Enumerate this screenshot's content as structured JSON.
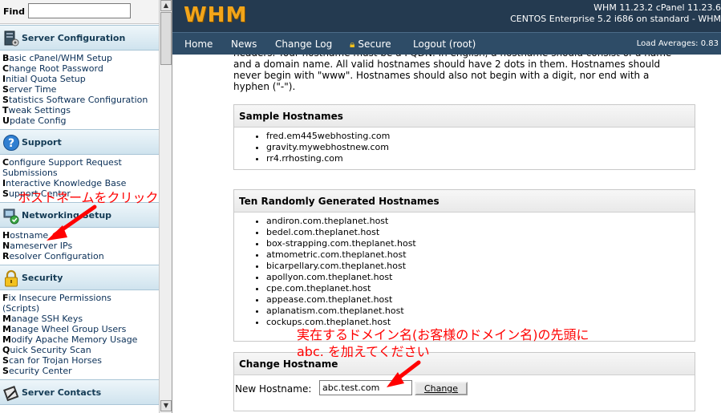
{
  "sidebar": {
    "find_label": "Find",
    "find_value": "",
    "sections": [
      {
        "title": "Server Configuration",
        "icon": "server-icon",
        "links": [
          {
            "first": "B",
            "rest": "asic cPanel/WHM Setup"
          },
          {
            "first": "C",
            "rest": "hange Root Password"
          },
          {
            "first": "I",
            "rest": "nitial Quota Setup"
          },
          {
            "first": "S",
            "rest": "erver Time"
          },
          {
            "first": "S",
            "rest": "tatistics Software Configuration"
          },
          {
            "first": "T",
            "rest": "weak Settings"
          },
          {
            "first": "U",
            "rest": "pdate Config"
          }
        ]
      },
      {
        "title": "Support",
        "icon": "help-icon",
        "links": [
          {
            "first": "C",
            "rest": "onfigure Support Request"
          },
          {
            "first": "",
            "rest": "Submissions"
          },
          {
            "first": "I",
            "rest": "nteractive Knowledge Base"
          },
          {
            "first": "S",
            "rest": "upport Center"
          }
        ]
      },
      {
        "title": "Networking Setup",
        "icon": "network-icon",
        "links": [
          {
            "first": "H",
            "rest": "ostname"
          },
          {
            "first": "N",
            "rest": "ameserver IPs"
          },
          {
            "first": "R",
            "rest": "esolver Configuration"
          }
        ]
      },
      {
        "title": "Security",
        "icon": "lock-icon",
        "links": [
          {
            "first": "F",
            "rest": "ix Insecure Permissions"
          },
          {
            "first": "",
            "rest": "(Scripts)"
          },
          {
            "first": "M",
            "rest": "anage SSH Keys"
          },
          {
            "first": "M",
            "rest": "anage Wheel Group Users"
          },
          {
            "first": "M",
            "rest": "odify Apache Memory Usage"
          },
          {
            "first": "Q",
            "rest": "uick Security Scan"
          },
          {
            "first": "S",
            "rest": "can for Trojan Horses"
          },
          {
            "first": "S",
            "rest": "ecurity Center"
          }
        ]
      },
      {
        "title": "Server Contacts",
        "icon": "contacts-icon",
        "links": []
      }
    ]
  },
  "header": {
    "logo": "WHM",
    "version_line1": "WHM 11.23.2 cPanel 11.23.6",
    "version_line2": "CENTOS Enterprise 5.2 i686 on standard - WHM",
    "nav": [
      "Home",
      "News",
      "Change Log",
      "Secure",
      "Logout (root)"
    ],
    "load_averages": "Load Averages: 0.83"
  },
  "content": {
    "intro": "headers. Your hostname must be a FQDN. In english, a hostname should consist of a name and a domain name. All valid hostnames should have 2 dots in them. Hostnames should never begin with \"www\". Hostnames should also not begin with a digit, nor end with a hyphen (\"-\").",
    "sample": {
      "title": "Sample Hostnames",
      "items": [
        "fred.em445webhosting.com",
        "gravity.mywebhostnew.com",
        "rr4.rrhosting.com"
      ]
    },
    "random": {
      "title": "Ten Randomly Generated Hostnames",
      "items": [
        "andiron.com.theplanet.host",
        "bedel.com.theplanet.host",
        "box-strapping.com.theplanet.host",
        "atmometric.com.theplanet.host",
        "bicarpellary.com.theplanet.host",
        "apollyon.com.theplanet.host",
        "cpe.com.theplanet.host",
        "appease.com.theplanet.host",
        "aplanatism.com.theplanet.host",
        "cockups.com.theplanet.host"
      ]
    },
    "change": {
      "title": "Change Hostname",
      "label": "New Hostname:",
      "value": "abc.test.com",
      "button": "Change"
    }
  },
  "annotations": {
    "click_hostname": "ホストネームをクリック",
    "domain_note_line1": "実在するドメイン名(お客様のドメイン名)の先頭に",
    "domain_note_line2": "abc. を加えてください"
  },
  "colors": {
    "header_bg": "#243a50",
    "nav_bg": "#2e4c67",
    "logo": "#f2a51a",
    "annotation": "#ff0000"
  }
}
